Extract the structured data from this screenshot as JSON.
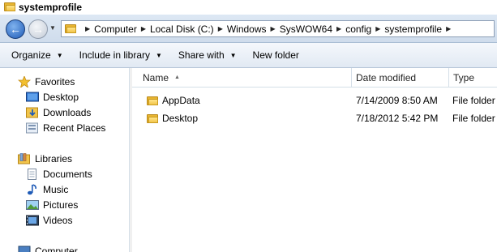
{
  "window": {
    "title": "systemprofile"
  },
  "address": {
    "crumbs": [
      "Computer",
      "Local Disk (C:)",
      "Windows",
      "SysWOW64",
      "config",
      "systemprofile"
    ]
  },
  "toolbar": {
    "organize": "Organize",
    "include_in_library": "Include in library",
    "share_with": "Share with",
    "new_folder": "New folder"
  },
  "navpane": {
    "favorites": "Favorites",
    "desktop": "Desktop",
    "downloads": "Downloads",
    "recent_places": "Recent Places",
    "libraries": "Libraries",
    "documents": "Documents",
    "music": "Music",
    "pictures": "Pictures",
    "videos": "Videos",
    "computer": "Computer"
  },
  "columns": {
    "name": "Name",
    "date_modified": "Date modified",
    "type": "Type"
  },
  "files": [
    {
      "name": "AppData",
      "date": "7/14/2009 8:50 AM",
      "type": "File folder"
    },
    {
      "name": "Desktop",
      "date": "7/18/2012 5:42 PM",
      "type": "File folder"
    }
  ]
}
